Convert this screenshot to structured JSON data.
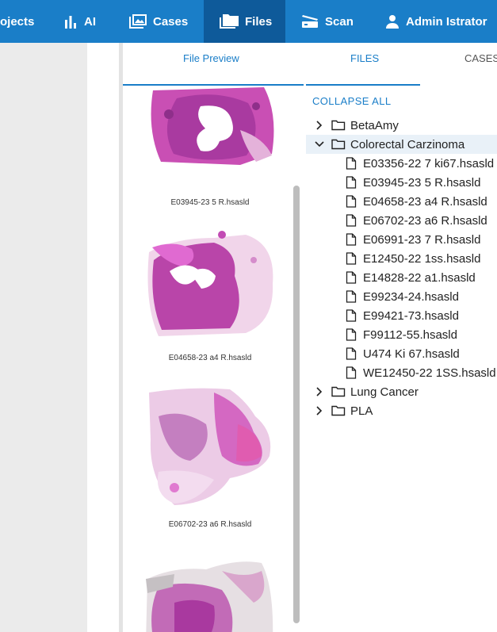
{
  "nav": {
    "projects_label": "ojects",
    "ai_label": "AI",
    "cases_label": "Cases",
    "files_label": "Files",
    "scan_label": "Scan",
    "user_label": "Admin Istrator"
  },
  "tabs": {
    "file_preview": "File Preview",
    "files": "FILES",
    "cases": "CASES"
  },
  "preview": {
    "captions": [
      "E03945-23 5 R.hsasld",
      "E04658-23 a4 R.hsasld",
      "E06702-23 a6 R.hsasld"
    ]
  },
  "tree": {
    "collapse_all": "COLLAPSE ALL",
    "folders": [
      "BetaAmy",
      "Colorectal Carzinoma",
      "Lung Cancer",
      "PLA"
    ],
    "files": [
      "E03356-22 7 ki67.hsasld",
      "E03945-23 5 R.hsasld",
      "E04658-23 a4 R.hsasld",
      "E06702-23 a6 R.hsasld",
      "E06991-23 7 R.hsasld",
      "E12450-22 1ss.hsasld",
      "E14828-22 a1.hsasld",
      "E99234-24.hsasld",
      "E99421-73.hsasld",
      "F99112-55.hsasld",
      "U474 Ki 67.hsasld",
      "WE12450-22 1SS.hsasld"
    ]
  },
  "colors": {
    "nav_bg": "#1a7ec8",
    "nav_active_bg": "#0e5a9a",
    "accent": "#1a7ec8",
    "selected_row": "#e9f1f8"
  }
}
